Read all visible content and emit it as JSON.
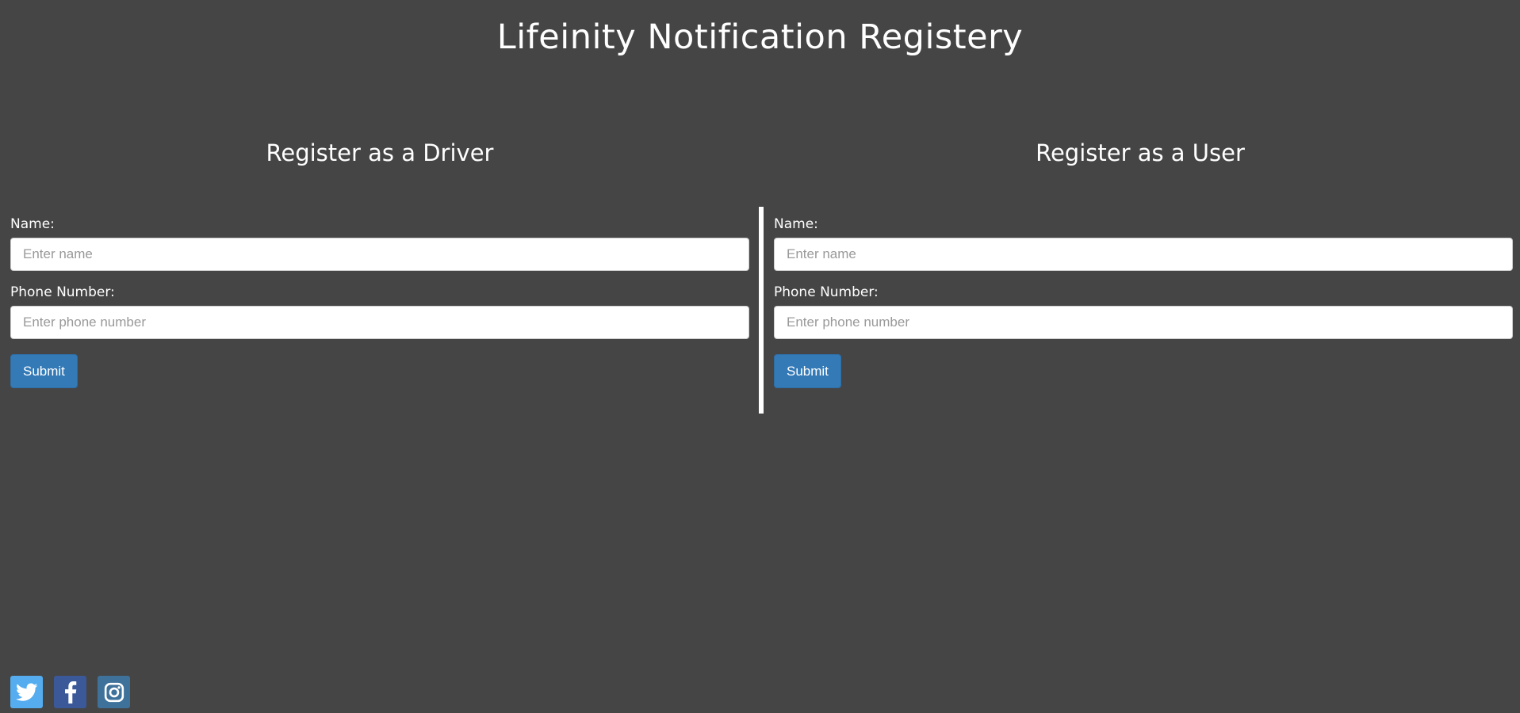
{
  "page": {
    "title": "Lifeinity Notification Registery"
  },
  "driver": {
    "heading": "Register as a Driver",
    "name_label": "Name:",
    "name_placeholder": "Enter name",
    "phone_label": "Phone Number:",
    "phone_placeholder": "Enter phone number",
    "submit_label": "Submit"
  },
  "user": {
    "heading": "Register as a User",
    "name_label": "Name:",
    "name_placeholder": "Enter name",
    "phone_label": "Phone Number:",
    "phone_placeholder": "Enter phone number",
    "submit_label": "Submit"
  },
  "social": [
    {
      "icon": "twitter-icon",
      "color": "#55acee"
    },
    {
      "icon": "facebook-icon",
      "color": "#3b5998"
    },
    {
      "icon": "instagram-icon",
      "color": "#3f729b"
    }
  ],
  "colors": {
    "background": "#454545",
    "primary_button": "#337ab7",
    "divider": "#ffffff"
  }
}
